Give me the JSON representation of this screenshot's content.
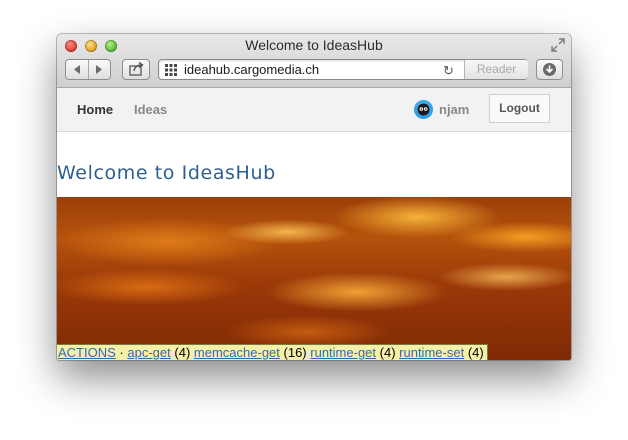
{
  "window": {
    "title": "Welcome to IdeasHub"
  },
  "toolbar": {
    "url": "ideahub.cargomedia.ch",
    "reader_label": "Reader",
    "icons": [
      "back-icon",
      "forward-icon",
      "share-icon",
      "grid-icon",
      "reload-icon",
      "download-icon",
      "fullscreen-icon"
    ]
  },
  "site_nav": {
    "home_label": "Home",
    "ideas_label": "Ideas",
    "username": "njam",
    "logout_label": "Logout"
  },
  "page": {
    "title": "Welcome to IdeasHub"
  },
  "actions_bar": {
    "label": "ACTIONS",
    "separator": "·",
    "items": [
      {
        "name": "apc-get",
        "count": "(4)"
      },
      {
        "name": "memcache-get",
        "count": "(16)"
      },
      {
        "name": "runtime-get",
        "count": "(4)"
      },
      {
        "name": "runtime-set",
        "count": "(4)"
      }
    ]
  },
  "colors": {
    "title_blue": "#2f5f8f",
    "link_blue": "#2a6db7",
    "actions_bg": "#f5f0a8"
  }
}
